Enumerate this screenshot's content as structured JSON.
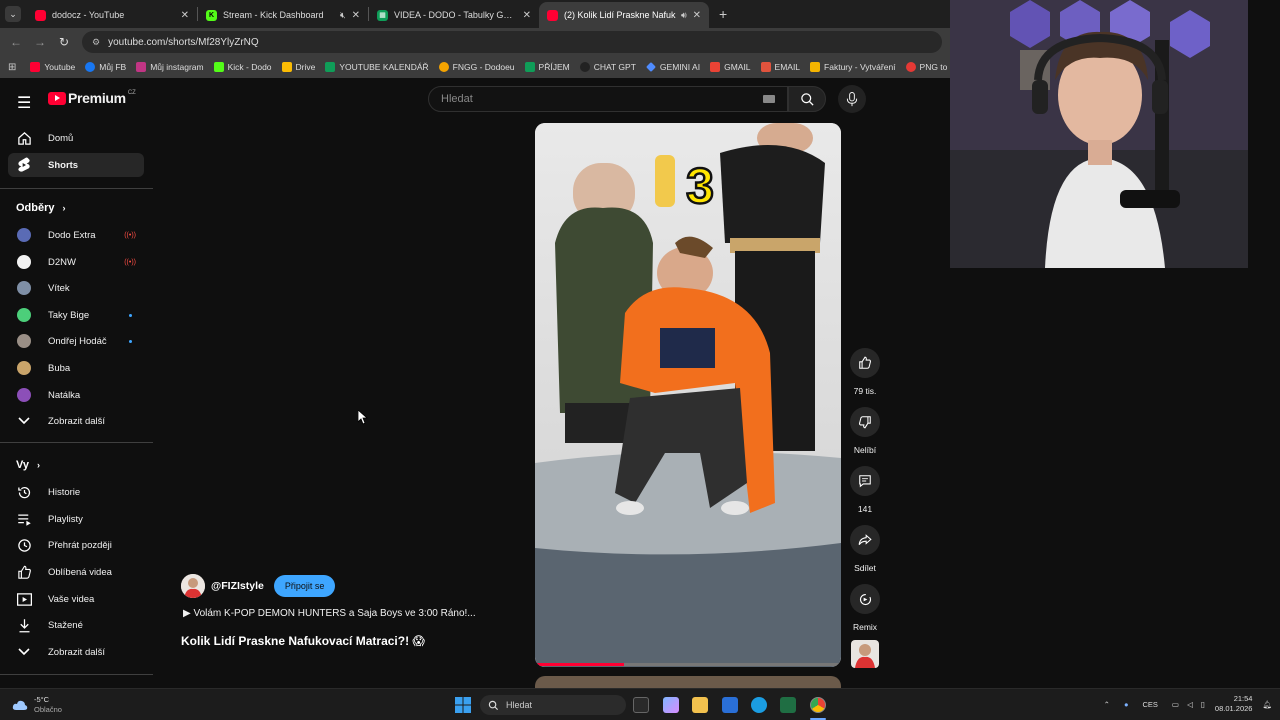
{
  "browser": {
    "tabs": [
      {
        "title": "dodocz - YouTube",
        "favicon_color": "#ff0033",
        "active": false
      },
      {
        "title": "Stream - Kick Dashboard",
        "favicon_color": "#53fc18",
        "active": false,
        "muted": true
      },
      {
        "title": "VIDEA - DODO - Tabulky Goog",
        "favicon_color": "#0f9d58",
        "active": false
      },
      {
        "title": "(2) Kolik Lidí Praskne Nafuk",
        "favicon_color": "#ff0033",
        "active": true,
        "audio": true
      }
    ],
    "url": "youtube.com/shorts/Mf28YlyZrNQ",
    "bookmarks": [
      {
        "label": "Youtube",
        "color": "#ff0033"
      },
      {
        "label": "Můj FB",
        "color": "#1877f2"
      },
      {
        "label": "Můj instagram",
        "color": "#c13584"
      },
      {
        "label": "Kick - Dodo",
        "color": "#53fc18"
      },
      {
        "label": "Drive",
        "color": "#fbbc04"
      },
      {
        "label": "YOUTUBE KALENDÁŘ",
        "color": "#0f9d58"
      },
      {
        "label": "FNGG - Dodoeu",
        "color": "#f4a300"
      },
      {
        "label": "PŘÍJEM",
        "color": "#0f9d58"
      },
      {
        "label": "CHAT GPT",
        "color": "#222222"
      },
      {
        "label": "GEMINI AI",
        "color": "#4f8cff"
      },
      {
        "label": "GMAIL",
        "color": "#ea4335"
      },
      {
        "label": "EMAIL",
        "color": "#e0533d"
      },
      {
        "label": "Faktury - Vytváření",
        "color": "#f4b400"
      },
      {
        "label": "PNG to PD",
        "color": "#e53935"
      }
    ]
  },
  "youtube": {
    "logo_text": "Premium",
    "logo_region": "CZ",
    "search_placeholder": "Hledat",
    "sidebar": {
      "main": [
        {
          "label": "Domů",
          "icon": "home-icon"
        },
        {
          "label": "Shorts",
          "icon": "shorts-icon",
          "active": true
        }
      ],
      "subs_heading": "Odběry",
      "subs": [
        {
          "label": "Dodo Extra",
          "live": true,
          "color": "#5a6bb5"
        },
        {
          "label": "D2NW",
          "live": true,
          "color": "#f2f2f2"
        },
        {
          "label": "Vítek",
          "color": "#7f8fa6"
        },
        {
          "label": "Taky Bige",
          "dot": true,
          "color": "#4ccf7a"
        },
        {
          "label": "Ondřej Hodáč",
          "dot": true,
          "color": "#9a8f86"
        },
        {
          "label": "Buba",
          "color": "#c9a46a"
        },
        {
          "label": "Natálka",
          "color": "#8c4fb8"
        }
      ],
      "subs_more": "Zobrazit další",
      "you_heading": "Vy",
      "you": [
        {
          "label": "Historie",
          "icon": "history-icon"
        },
        {
          "label": "Playlisty",
          "icon": "playlist-icon"
        },
        {
          "label": "Přehrát později",
          "icon": "watch-later-icon"
        },
        {
          "label": "Oblíbená videa",
          "icon": "like-icon"
        },
        {
          "label": "Vaše videa",
          "icon": "your-videos-icon"
        },
        {
          "label": "Stažené",
          "icon": "download-icon"
        }
      ],
      "you_more": "Zobrazit další"
    },
    "short": {
      "overlay_number": "3",
      "channel": "@FIZIstyle",
      "subscribe_label": "Připojit se",
      "song": "▶ Volám K-POP DEMON HUNTERS a Saja Boys ve 3:00 Ráno!...",
      "title": "Kolik Lidí Praskne Nafukovací Matraci?! 😱",
      "progress": 0.29,
      "actions": {
        "likes": "79 tis.",
        "dislike": "Nelíbí",
        "comments": "141",
        "share": "Sdílet",
        "remix": "Remix"
      }
    }
  },
  "taskbar": {
    "temperature": "-5°C",
    "weather": "Oblačno",
    "search_placeholder": "Hledat",
    "language": "CES",
    "time": "21:54",
    "date": "08.01.2026"
  }
}
